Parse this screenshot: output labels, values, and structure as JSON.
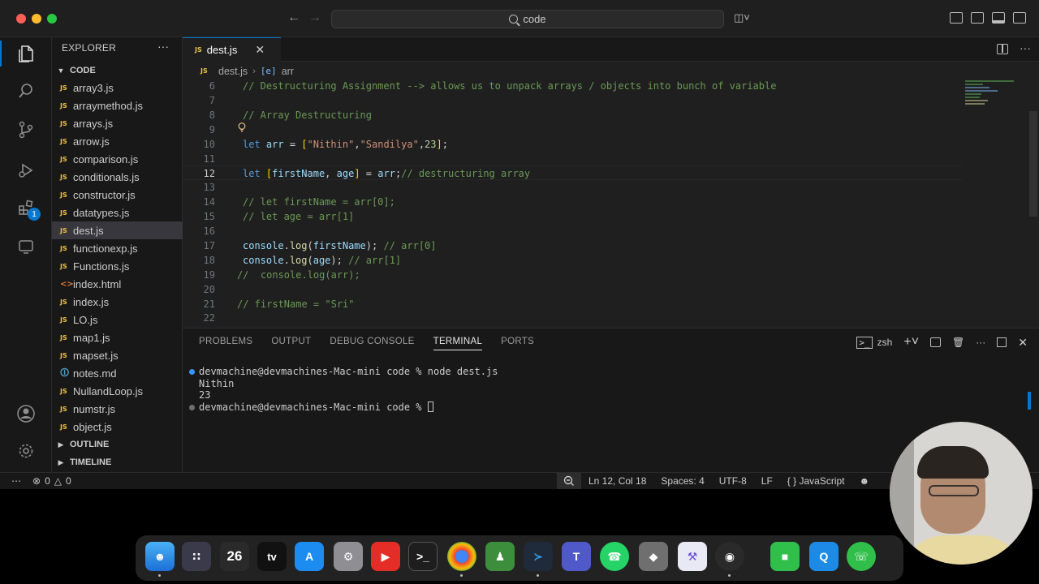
{
  "titlebar": {
    "search_text": "code"
  },
  "explorer": {
    "title": "EXPLORER",
    "more": "···",
    "folder_name": "CODE",
    "files": [
      {
        "name": "array3.js",
        "type": "js"
      },
      {
        "name": "arraymethod.js",
        "type": "js"
      },
      {
        "name": "arrays.js",
        "type": "js"
      },
      {
        "name": "arrow.js",
        "type": "js"
      },
      {
        "name": "comparison.js",
        "type": "js"
      },
      {
        "name": "conditionals.js",
        "type": "js"
      },
      {
        "name": "constructor.js",
        "type": "js"
      },
      {
        "name": "datatypes.js",
        "type": "js"
      },
      {
        "name": "dest.js",
        "type": "js"
      },
      {
        "name": "functionexp.js",
        "type": "js"
      },
      {
        "name": "Functions.js",
        "type": "js"
      },
      {
        "name": "index.html",
        "type": "html"
      },
      {
        "name": "index.js",
        "type": "js"
      },
      {
        "name": "LO.js",
        "type": "js"
      },
      {
        "name": "map1.js",
        "type": "js"
      },
      {
        "name": "mapset.js",
        "type": "js"
      },
      {
        "name": "notes.md",
        "type": "md"
      },
      {
        "name": "NullandLoop.js",
        "type": "js"
      },
      {
        "name": "numstr.js",
        "type": "js"
      },
      {
        "name": "object.js",
        "type": "js"
      }
    ],
    "selected_file": "dest.js",
    "outline_label": "OUTLINE",
    "timeline_label": "TIMELINE"
  },
  "activity_badge": "1",
  "editor": {
    "tab_label": "dest.js",
    "file_icon_text": "JS",
    "breadcrumb_file": "dest.js",
    "breadcrumb_symbol": "arr",
    "lines": [
      {
        "n": "6",
        "text": "// Destructuring Assignment --> allows us to unpack arrays / objects into bunch of variable"
      },
      {
        "n": "7",
        "text": ""
      },
      {
        "n": "8",
        "text": "// Array Destructuring"
      },
      {
        "n": "9",
        "text": ""
      },
      {
        "n": "10",
        "text": "let arr = [\"Nithin\",\"Sandilya\",23];"
      },
      {
        "n": "11",
        "text": ""
      },
      {
        "n": "12",
        "text": "let [firstName, age] = arr;// destructuring array"
      },
      {
        "n": "13",
        "text": ""
      },
      {
        "n": "14",
        "text": "// let firstName = arr[0];"
      },
      {
        "n": "15",
        "text": "// let age = arr[1]"
      },
      {
        "n": "16",
        "text": ""
      },
      {
        "n": "17",
        "text": "console.log(firstName); // arr[0]"
      },
      {
        "n": "18",
        "text": "console.log(age); // arr[1]"
      },
      {
        "n": "19",
        "text": "//  console.log(arr);"
      },
      {
        "n": "20",
        "text": ""
      },
      {
        "n": "21",
        "text": "// firstName = \"Sri\""
      },
      {
        "n": "22",
        "text": ""
      }
    ]
  },
  "panel": {
    "tabs": [
      "PROBLEMS",
      "OUTPUT",
      "DEBUG CONSOLE",
      "TERMINAL",
      "PORTS"
    ],
    "active_tab": "TERMINAL",
    "shell": "zsh",
    "terminal_lines": [
      "devmachine@devmachines-Mac-mini code % node dest.js",
      "Nithin",
      "23",
      "devmachine@devmachines-Mac-mini code % "
    ]
  },
  "statusbar": {
    "errors": "0",
    "warnings": "0",
    "position": "Ln 12, Col 18",
    "spaces": "Spaces: 4",
    "encoding": "UTF-8",
    "eol": "LF",
    "language": "JavaScript"
  },
  "dock": {
    "calendar_day": "26",
    "tv_label": "tv"
  },
  "colors": {
    "accent": "#0078d4",
    "editor_bg": "#1f1f1f",
    "sidebar_bg": "#181818",
    "comment": "#6a9955",
    "keyword": "#569cd6",
    "string": "#ce9178"
  }
}
